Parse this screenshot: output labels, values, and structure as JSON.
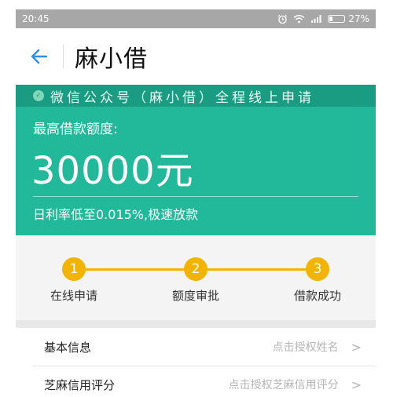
{
  "status_bar": {
    "time": "20:45",
    "battery": "27%"
  },
  "header": {
    "title": "麻小借"
  },
  "hero": {
    "banner": "微信公众号（麻小借）全程线上申请",
    "limit_label": "最高借款额度:",
    "limit_amount": "30000元",
    "rate_text": "日利率低至0.015%,极速放款"
  },
  "steps": [
    {
      "number": "1",
      "label": "在线申请"
    },
    {
      "number": "2",
      "label": "额度审批"
    },
    {
      "number": "3",
      "label": "借款成功"
    }
  ],
  "list": [
    {
      "label": "基本信息",
      "hint": "点击授权姓名",
      "chevron": ">"
    },
    {
      "label": "芝麻信用评分",
      "hint": "点击授权芝麻信用评分",
      "chevron": ">"
    }
  ],
  "colors": {
    "accent_green": "#22b89a",
    "banner_green": "#1a9c82",
    "step_yellow": "#f2b400",
    "back_blue": "#2f8ee6"
  }
}
